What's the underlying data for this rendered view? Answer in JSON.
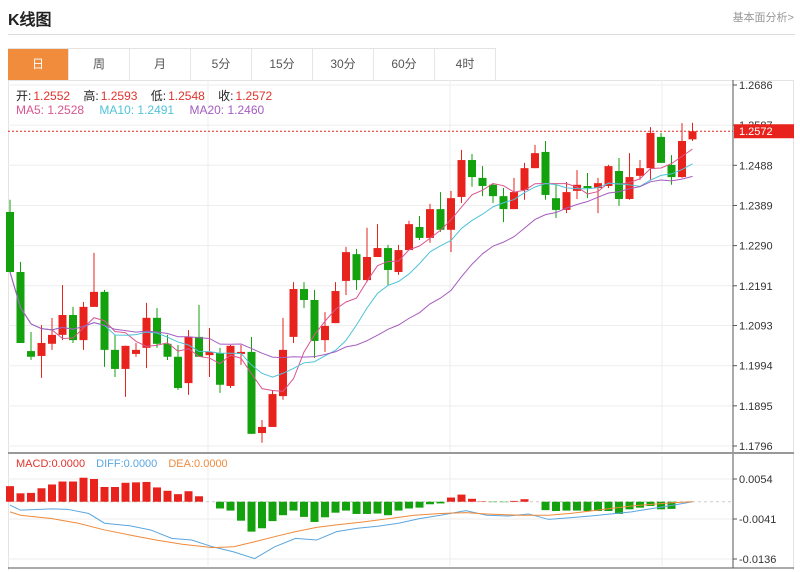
{
  "header": {
    "title": "K线图",
    "link": "基本面分析>"
  },
  "tabs": [
    {
      "label": "日",
      "active": true
    },
    {
      "label": "周"
    },
    {
      "label": "月"
    },
    {
      "label": "5分"
    },
    {
      "label": "15分"
    },
    {
      "label": "30分"
    },
    {
      "label": "60分"
    },
    {
      "label": "4时"
    }
  ],
  "ohlc_legend": {
    "open_label": "开:",
    "open": "1.2552",
    "high_label": "高:",
    "high": "1.2593",
    "low_label": "低:",
    "low": "1.2548",
    "close_label": "收:",
    "close": "1.2572"
  },
  "ma_legend": {
    "ma5": "MA5: 1.2528",
    "ma10": "MA10: 1.2491",
    "ma20": "MA20: 1.2460"
  },
  "macd_legend": {
    "macd": "MACD:0.0000",
    "diff": "DIFF:0.0000",
    "dea": "DEA:0.0000"
  },
  "colors": {
    "up": "#e8231d",
    "down": "#13a10e",
    "ma5": "#d9558f",
    "ma10": "#4fc3d9",
    "ma20": "#a55cc0",
    "diff": "#5aa6e0",
    "dea": "#ef8a3c",
    "accent": "#f08c3c"
  },
  "chart_data": [
    {
      "type": "candlestick",
      "title": "",
      "ylim": [
        1.1796,
        1.2686
      ],
      "y_ticks": [
        "1.2686",
        "1.2587",
        "1.2488",
        "1.2389",
        "1.2290",
        "1.2191",
        "1.2093",
        "1.1994",
        "1.1895",
        "1.1796"
      ],
      "last_price": "1.2572",
      "grid": true,
      "ohlc": [
        [
          1.2373,
          1.2403,
          1.2225,
          1.2225
        ],
        [
          1.2225,
          1.225,
          1.205,
          1.205
        ],
        [
          1.203,
          1.2077,
          1.2008,
          1.2016
        ],
        [
          1.2018,
          1.2094,
          1.1964,
          1.205
        ],
        [
          1.2048,
          1.2112,
          1.2033,
          1.207
        ],
        [
          1.207,
          1.2193,
          1.2057,
          1.2119
        ],
        [
          1.2119,
          1.2139,
          1.205,
          1.2057
        ],
        [
          1.2057,
          1.2151,
          1.2033,
          1.2139
        ],
        [
          1.2139,
          1.2272,
          1.2139,
          1.2176
        ],
        [
          1.2176,
          1.2181,
          1.1991,
          1.2033
        ],
        [
          1.2033,
          1.207,
          1.1966,
          1.1986
        ],
        [
          1.1986,
          1.2043,
          1.1917,
          1.2043
        ],
        [
          1.2023,
          1.205,
          1.2016,
          1.2033
        ],
        [
          1.2038,
          1.2149,
          1.1988,
          1.2112
        ],
        [
          1.2112,
          1.2136,
          1.2038,
          1.2048
        ],
        [
          1.2048,
          1.207,
          1.2008,
          1.2016
        ],
        [
          1.2016,
          1.2045,
          1.1934,
          1.1939
        ],
        [
          1.1951,
          1.2082,
          1.1922,
          1.2065
        ],
        [
          1.2065,
          1.2144,
          1.2016,
          1.2016
        ],
        [
          1.202,
          1.2087,
          1.1966,
          1.2028
        ],
        [
          1.2025,
          1.2038,
          1.1927,
          1.1947
        ],
        [
          1.1944,
          1.2045,
          1.1939,
          1.2043
        ],
        [
          1.2023,
          1.2045,
          1.1996,
          1.2028
        ],
        [
          1.2028,
          1.2065,
          1.1826,
          1.1826
        ],
        [
          1.1828,
          1.186,
          1.1804,
          1.1843
        ],
        [
          1.1843,
          1.1934,
          1.1843,
          1.1924
        ],
        [
          1.1919,
          1.2112,
          1.191,
          1.2033
        ],
        [
          1.2065,
          1.22,
          1.205,
          1.2183
        ],
        [
          1.2183,
          1.22,
          1.2136,
          1.2156
        ],
        [
          1.2156,
          1.2181,
          1.2013,
          1.2055
        ],
        [
          1.2057,
          1.2126,
          1.2028,
          1.2092
        ],
        [
          1.2099,
          1.22,
          1.2099,
          1.2178
        ],
        [
          1.2203,
          1.2287,
          1.2168,
          1.2274
        ],
        [
          1.2269,
          1.2282,
          1.2181,
          1.2205
        ],
        [
          1.2205,
          1.2334,
          1.22,
          1.2262
        ],
        [
          1.2262,
          1.2343,
          1.2262,
          1.2284
        ],
        [
          1.2284,
          1.2292,
          1.2191,
          1.223
        ],
        [
          1.2225,
          1.2292,
          1.2218,
          1.2279
        ],
        [
          1.2279,
          1.2351,
          1.2279,
          1.2343
        ],
        [
          1.2336,
          1.2363,
          1.2304,
          1.2309
        ],
        [
          1.2309,
          1.2393,
          1.2297,
          1.238
        ],
        [
          1.238,
          1.2422,
          1.2324,
          1.2329
        ],
        [
          1.2329,
          1.2425,
          1.2274,
          1.2407
        ],
        [
          1.241,
          1.2526,
          1.2395,
          1.2501
        ],
        [
          1.2501,
          1.2516,
          1.2435,
          1.2459
        ],
        [
          1.2457,
          1.2486,
          1.2412,
          1.2437
        ],
        [
          1.244,
          1.2444,
          1.2395,
          1.2412
        ],
        [
          1.2412,
          1.2432,
          1.2348,
          1.238
        ],
        [
          1.238,
          1.2457,
          1.238,
          1.2422
        ],
        [
          1.2427,
          1.2494,
          1.2403,
          1.2481
        ],
        [
          1.2481,
          1.2538,
          1.2481,
          1.2518
        ],
        [
          1.2521,
          1.2548,
          1.2403,
          1.2415
        ],
        [
          1.2407,
          1.244,
          1.2358,
          1.2378
        ],
        [
          1.2378,
          1.2447,
          1.237,
          1.2422
        ],
        [
          1.2425,
          1.2476,
          1.2405,
          1.244
        ],
        [
          1.2437,
          1.2469,
          1.2407,
          1.2432
        ],
        [
          1.2432,
          1.2457,
          1.237,
          1.2444
        ],
        [
          1.2437,
          1.2489,
          1.2432,
          1.2486
        ],
        [
          1.2474,
          1.2506,
          1.2388,
          1.2405
        ],
        [
          1.2405,
          1.2518,
          1.2403,
          1.2459
        ],
        [
          1.2462,
          1.2501,
          1.2452,
          1.2481
        ],
        [
          1.2481,
          1.2582,
          1.2452,
          1.2568
        ],
        [
          1.2558,
          1.2568,
          1.2494,
          1.2494
        ],
        [
          1.2489,
          1.2513,
          1.244,
          1.2459
        ],
        [
          1.2459,
          1.2592,
          1.2457,
          1.2548
        ],
        [
          1.2552,
          1.2593,
          1.2548,
          1.2572
        ]
      ],
      "ohlc_order": [
        "open",
        "high",
        "low",
        "close"
      ],
      "moving_averages": [
        "MA5",
        "MA10",
        "MA20"
      ]
    },
    {
      "type": "bar+line",
      "title": "",
      "ylim": [
        -0.0136,
        0.0054
      ],
      "y_ticks": [
        "0.0054",
        "-0.0041",
        "-0.0136"
      ],
      "macd_histogram": [
        0.0037,
        0.002,
        0.0021,
        0.0032,
        0.0041,
        0.0048,
        0.0048,
        0.0057,
        0.0054,
        0.0035,
        0.0035,
        0.0045,
        0.0046,
        0.0047,
        0.0034,
        0.0026,
        0.0018,
        0.0025,
        0.0013,
        0,
        -0.0016,
        -0.0021,
        -0.0045,
        -0.0071,
        -0.0063,
        -0.0046,
        -0.0032,
        -0.0021,
        -0.0036,
        -0.0048,
        -0.0037,
        -0.0026,
        -0.0021,
        -0.0029,
        -0.0029,
        -0.0028,
        -0.0032,
        -0.0021,
        -0.0016,
        -0.0014,
        -0.0006,
        -0.0004,
        0.001,
        0.0017,
        0.0007,
        0.0001,
        -0.0001,
        -0.0001,
        0.0002,
        0.0006,
        0,
        -0.002,
        -0.0022,
        -0.0021,
        -0.0021,
        -0.0022,
        -0.0022,
        -0.0022,
        -0.0029,
        -0.0018,
        -0.0014,
        -0.001,
        -0.0018,
        -0.0017,
        0,
        0
      ],
      "diff": [
        [
          0,
          -0.0008
        ],
        [
          1,
          -0.002
        ],
        [
          4,
          -0.0017
        ],
        [
          5.5,
          -0.0018
        ],
        [
          7.5,
          -0.0028
        ],
        [
          9,
          -0.0051
        ],
        [
          11.4,
          -0.0057
        ],
        [
          13.4,
          -0.0067
        ],
        [
          15.4,
          -0.0087
        ],
        [
          17.3,
          -0.0091
        ],
        [
          19.3,
          -0.0107
        ],
        [
          21.3,
          -0.0119
        ],
        [
          23.3,
          -0.0135
        ],
        [
          25.2,
          -0.0107
        ],
        [
          27.2,
          -0.0087
        ],
        [
          29.2,
          -0.0091
        ],
        [
          31.1,
          -0.0071
        ],
        [
          33.1,
          -0.0063
        ],
        [
          35.1,
          -0.0058
        ],
        [
          37,
          -0.0051
        ],
        [
          39,
          -0.004
        ],
        [
          41,
          -0.0032
        ],
        [
          43.4,
          -0.0021
        ],
        [
          45.4,
          -0.0032
        ],
        [
          47.4,
          -0.0034
        ],
        [
          49.4,
          -0.0029
        ],
        [
          51.3,
          -0.0042
        ],
        [
          53.3,
          -0.0038
        ],
        [
          55.3,
          -0.0034
        ],
        [
          57.2,
          -0.0029
        ],
        [
          59.2,
          -0.0024
        ],
        [
          61.2,
          -0.0016
        ],
        [
          63.2,
          -0.0008
        ],
        [
          65,
          0
        ]
      ],
      "dea": [
        [
          0,
          -0.0024
        ],
        [
          1,
          -0.0032
        ],
        [
          4,
          -0.004
        ],
        [
          6.5,
          -0.0051
        ],
        [
          9,
          -0.0067
        ],
        [
          11.4,
          -0.0079
        ],
        [
          13.9,
          -0.0091
        ],
        [
          16.4,
          -0.0101
        ],
        [
          19.3,
          -0.0109
        ],
        [
          21.3,
          -0.0107
        ],
        [
          23.3,
          -0.0095
        ],
        [
          25.2,
          -0.0083
        ],
        [
          27.2,
          -0.0071
        ],
        [
          29.2,
          -0.0061
        ],
        [
          31.1,
          -0.0055
        ],
        [
          33.6,
          -0.0048
        ],
        [
          36.1,
          -0.004
        ],
        [
          38.5,
          -0.0032
        ],
        [
          41,
          -0.0028
        ],
        [
          43.4,
          -0.0026
        ],
        [
          45.4,
          -0.0029
        ],
        [
          48.4,
          -0.0032
        ],
        [
          51.3,
          -0.0032
        ],
        [
          53.3,
          -0.0028
        ],
        [
          55.3,
          -0.0022
        ],
        [
          57.2,
          -0.0016
        ],
        [
          59.2,
          -0.001
        ],
        [
          61.2,
          -0.0006
        ],
        [
          63.2,
          -0.0002
        ],
        [
          65,
          0
        ]
      ]
    }
  ]
}
